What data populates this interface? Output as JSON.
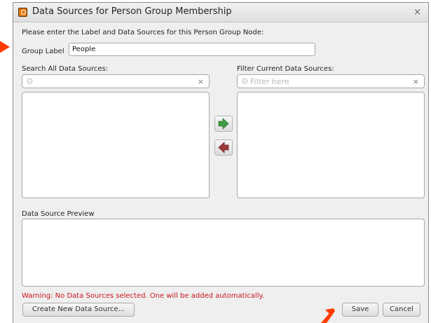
{
  "dialog": {
    "title": "Data Sources for Person Group Membership",
    "close_label": "×",
    "instruction": "Please enter the Label and Data Sources for this Person Group Node:"
  },
  "group": {
    "label": "Group Label",
    "value": "People"
  },
  "search_all": {
    "label": "Search All Data Sources:",
    "placeholder": "",
    "clear_label": "×"
  },
  "filter_current": {
    "label": "Filter Current Data Sources:",
    "placeholder": "Filter here",
    "clear_label": "×"
  },
  "transfer": {
    "add_icon": "green-right-arrow",
    "remove_icon": "red-left-arrow",
    "add_color": "#3f9b45",
    "remove_color": "#9a3a3a"
  },
  "preview": {
    "label": "Data Source Preview"
  },
  "warning": {
    "text": "Warning: No Data Sources selected. One will be added automatically.",
    "color": "#c8161d"
  },
  "buttons": {
    "create_new": "Create New Data Source...",
    "save": "Save",
    "cancel": "Cancel"
  },
  "annotation_color": "#ff3b00"
}
